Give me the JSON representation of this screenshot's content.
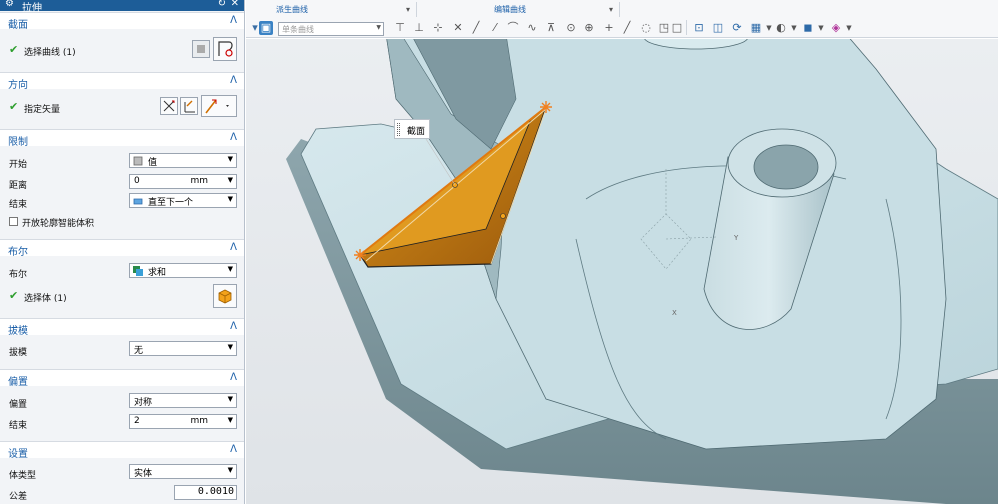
{
  "dialog": {
    "title": "拉伸",
    "sections": {
      "section": {
        "header": "截面",
        "select_curve_label": "选择曲线 (1)"
      },
      "direction": {
        "header": "方向",
        "specify_vector_label": "指定矢量"
      },
      "limits": {
        "header": "限制",
        "start_label": "开始",
        "start_value": "值",
        "distance_label": "距离",
        "distance_value": "0",
        "distance_unit": "mm",
        "end_label": "结束",
        "end_value": "直至下一个",
        "open_profile_label": "开放轮廓智能体积"
      },
      "boolean": {
        "header": "布尔",
        "boolean_label": "布尔",
        "boolean_value": "求和",
        "select_body_label": "选择体 (1)"
      },
      "draft": {
        "header": "拔模",
        "draft_label": "拔模",
        "draft_value": "无"
      },
      "offset": {
        "header": "偏置",
        "offset_label": "偏置",
        "offset_value": "对称",
        "end_label": "结束",
        "end_value": "2",
        "end_unit": "mm"
      },
      "settings": {
        "header": "设置",
        "body_type_label": "体类型",
        "body_type_value": "实体",
        "tolerance_label": "公差",
        "tolerance_value": "0.0010"
      }
    }
  },
  "toolbar": {
    "group_derived_curve": "派生曲线",
    "group_edit_curve": "编辑曲线",
    "filter_placeholder": "单条曲线"
  },
  "viewport": {
    "tooltip": "截面",
    "axis_y": "Y",
    "axis_x": "X"
  },
  "colors": {
    "accent": "#1b5fa8",
    "titlebar": "#1d5d98",
    "check": "#2e9e2e",
    "preview_fill": "#c67f12",
    "model_face": "#c7dfe5"
  }
}
